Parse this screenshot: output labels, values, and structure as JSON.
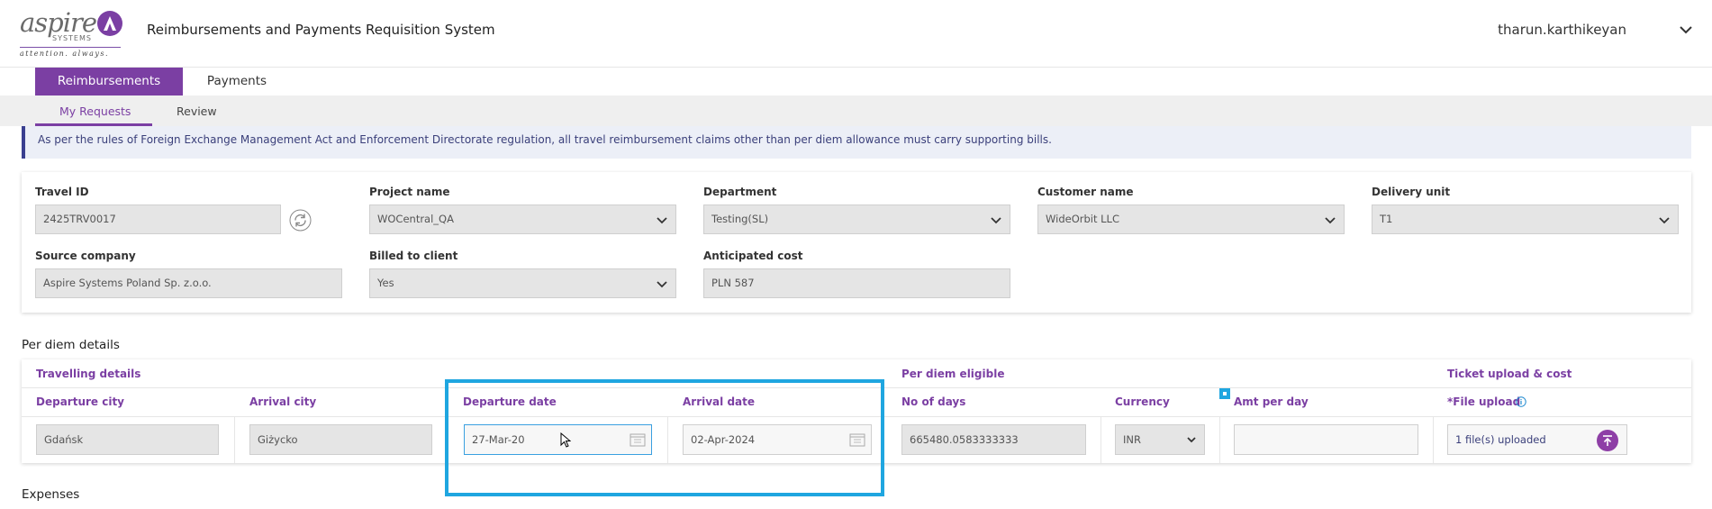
{
  "header": {
    "logo_word": "aspire",
    "logo_sub": "SYSTEMS",
    "logo_tagline": "attention. always.",
    "app_title": "Reimbursements and Payments Requisition System",
    "user_name": "tharun.karthikeyan"
  },
  "main_tabs": [
    {
      "label": "Reimbursements",
      "active": true
    },
    {
      "label": "Payments",
      "active": false
    }
  ],
  "sub_tabs": [
    {
      "label": "My Requests",
      "active": true
    },
    {
      "label": "Review",
      "active": false
    }
  ],
  "notice": "As per the rules of Foreign Exchange Management Act and Enforcement Directorate regulation, all travel reimbursement claims other than per diem allowance must carry supporting bills.",
  "form": {
    "travel_id": {
      "label": "Travel ID",
      "value": "2425TRV0017"
    },
    "project_name": {
      "label": "Project name",
      "value": "WOCentral_QA"
    },
    "department": {
      "label": "Department",
      "value": "Testing(SL)"
    },
    "customer_name": {
      "label": "Customer name",
      "value": "WideOrbit LLC"
    },
    "delivery_unit": {
      "label": "Delivery unit",
      "value": "T1"
    },
    "source_company": {
      "label": "Source company",
      "value": "Aspire Systems Poland Sp. z.o.o."
    },
    "billed_to_client": {
      "label": "Billed to client",
      "value": "Yes"
    },
    "anticipated_cost": {
      "label": "Anticipated cost",
      "value": "PLN 587"
    }
  },
  "per_diem": {
    "section_title": "Per diem details",
    "groups": {
      "travelling": "Travelling details",
      "eligible": "Per diem eligible",
      "ticket": "Ticket upload & cost"
    },
    "columns": {
      "departure_city": "Departure city",
      "arrival_city": "Arrival city",
      "departure_date": "Departure date",
      "arrival_date": "Arrival date",
      "no_of_days": "No of days",
      "currency": "Currency",
      "amt_per_day": "Amt per day",
      "file_upload": "*File upload"
    },
    "row": {
      "departure_city": "Gdańsk",
      "arrival_city": "Giżycko",
      "departure_date": "27-Mar-20",
      "arrival_date": "02-Apr-2024",
      "no_of_days": "665480.0583333333",
      "currency": "INR",
      "amt_per_day": "",
      "file_upload": "1 file(s) uploaded"
    }
  },
  "expenses_title": "Expenses",
  "colors": {
    "accent": "#7b3fa3",
    "highlight": "#1fa6e0",
    "notice_bg": "#eceff7"
  }
}
